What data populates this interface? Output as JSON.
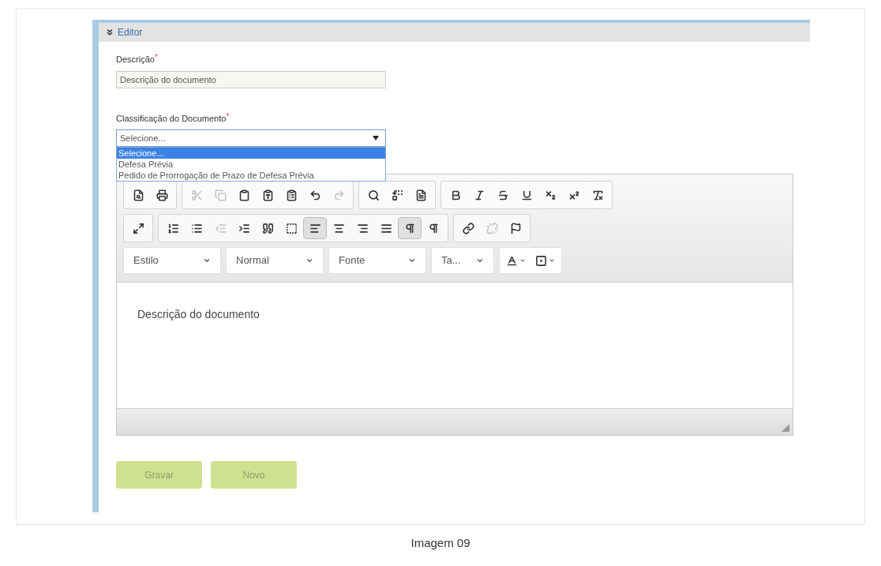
{
  "panel": {
    "title": "Editor"
  },
  "fields": [
    {
      "label": "Descrição",
      "required_mark": "*",
      "value": "Descrição do documento"
    },
    {
      "label": "Classificação do Documento",
      "required_mark": "*",
      "value": "Selecione..."
    }
  ],
  "dropdown_options": [
    {
      "label": "Selecione...",
      "selected": true
    },
    {
      "label": "Defesa Prévia",
      "selected": false
    },
    {
      "label": "Pedido de Prorrogação de Prazo de Defesa Prévia",
      "selected": false
    }
  ],
  "toolbar_rows": [
    [
      [
        {
          "kind": "preview",
          "selected": false,
          "disabled": false
        },
        {
          "kind": "print",
          "selected": false,
          "disabled": false
        }
      ],
      [
        {
          "kind": "cut",
          "selected": false,
          "disabled": true
        },
        {
          "kind": "copy",
          "selected": false,
          "disabled": true
        },
        {
          "kind": "paste",
          "selected": false,
          "disabled": false
        },
        {
          "kind": "paste-text",
          "selected": false,
          "disabled": false
        },
        {
          "kind": "paste-word",
          "selected": false,
          "disabled": false
        },
        {
          "kind": "undo",
          "selected": false,
          "disabled": false
        },
        {
          "kind": "redo",
          "selected": false,
          "disabled": true
        }
      ],
      [
        {
          "kind": "find",
          "selected": false,
          "disabled": false
        },
        {
          "kind": "replace",
          "selected": false,
          "disabled": false
        },
        {
          "kind": "select-all",
          "selected": false,
          "disabled": false
        }
      ],
      [
        {
          "kind": "bold",
          "selected": false,
          "disabled": false
        },
        {
          "kind": "italic",
          "selected": false,
          "disabled": false
        },
        {
          "kind": "strike",
          "selected": false,
          "disabled": false
        },
        {
          "kind": "underline",
          "selected": false,
          "disabled": false
        },
        {
          "kind": "subscript",
          "selected": false,
          "disabled": false
        },
        {
          "kind": "superscript",
          "selected": false,
          "disabled": false
        },
        {
          "kind": "clear-format",
          "selected": false,
          "disabled": false
        }
      ]
    ],
    [
      [
        {
          "kind": "maximize",
          "selected": false,
          "disabled": false
        }
      ],
      [
        {
          "kind": "numbered-list",
          "selected": false,
          "disabled": false
        },
        {
          "kind": "bullet-list",
          "selected": false,
          "disabled": false
        },
        {
          "kind": "outdent",
          "selected": false,
          "disabled": true
        },
        {
          "kind": "indent",
          "selected": false,
          "disabled": false
        },
        {
          "kind": "quote",
          "selected": false,
          "disabled": false
        },
        {
          "kind": "div",
          "selected": false,
          "disabled": false
        },
        {
          "kind": "align-left",
          "selected": true,
          "disabled": false
        },
        {
          "kind": "align-center",
          "selected": false,
          "disabled": false
        },
        {
          "kind": "align-right",
          "selected": false,
          "disabled": false
        },
        {
          "kind": "justify",
          "selected": false,
          "disabled": false
        },
        {
          "kind": "ltr",
          "selected": true,
          "disabled": false
        },
        {
          "kind": "rtl",
          "selected": false,
          "disabled": false
        }
      ],
      [
        {
          "kind": "link",
          "selected": false,
          "disabled": false
        },
        {
          "kind": "unlink",
          "selected": false,
          "disabled": true
        },
        {
          "kind": "flag",
          "selected": false,
          "disabled": false
        }
      ]
    ]
  ],
  "format_selects": [
    {
      "label": "Estilo"
    },
    {
      "label": "Normal"
    },
    {
      "label": "Fonte"
    },
    {
      "label": "Ta..."
    }
  ],
  "color_buttons": [
    {
      "kind": "text-color"
    },
    {
      "kind": "background-color"
    }
  ],
  "editor_content": "Descrição do documento",
  "buttons": [
    {
      "label": "Gravar"
    },
    {
      "label": "Novo"
    }
  ],
  "caption": "Imagem 09"
}
